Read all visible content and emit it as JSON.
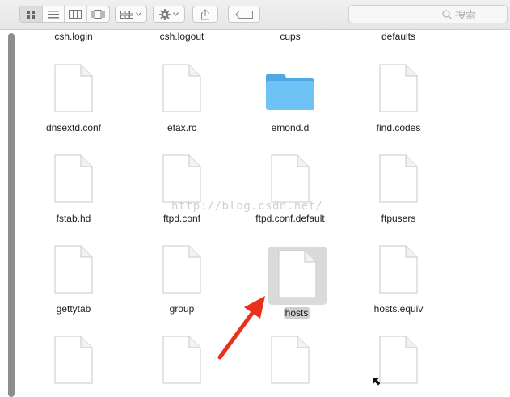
{
  "toolbar": {
    "view_modes": [
      "icon-view",
      "list-view",
      "column-view",
      "cover-flow-view"
    ],
    "arrange_icon": "grid-arrange-icon",
    "action_icon": "gear-icon",
    "share_icon": "share-icon",
    "tags_icon": "tag-icon",
    "search_placeholder": "搜索"
  },
  "files": {
    "row0": [
      {
        "label": "csh.login",
        "kind": "document"
      },
      {
        "label": "csh.logout",
        "kind": "document"
      },
      {
        "label": "cups",
        "kind": "folder"
      },
      {
        "label": "defaults",
        "kind": "folder"
      }
    ],
    "row1": [
      {
        "label": "dnsextd.conf",
        "kind": "document"
      },
      {
        "label": "efax.rc",
        "kind": "document"
      },
      {
        "label": "emond.d",
        "kind": "folder"
      },
      {
        "label": "find.codes",
        "kind": "document"
      }
    ],
    "row2": [
      {
        "label": "fstab.hd",
        "kind": "document"
      },
      {
        "label": "ftpd.conf",
        "kind": "document"
      },
      {
        "label": "ftpd.conf.default",
        "kind": "document"
      },
      {
        "label": "ftpusers",
        "kind": "document"
      }
    ],
    "row3": [
      {
        "label": "gettytab",
        "kind": "document"
      },
      {
        "label": "group",
        "kind": "document"
      },
      {
        "label": "hosts",
        "kind": "document",
        "selected": true
      },
      {
        "label": "hosts.equiv",
        "kind": "document"
      }
    ]
  },
  "watermark": "http://blog.csdn.net/",
  "colors": {
    "folder": "#5ab6f0",
    "annotation_arrow": "#e8321e",
    "selection": "#dadada"
  }
}
